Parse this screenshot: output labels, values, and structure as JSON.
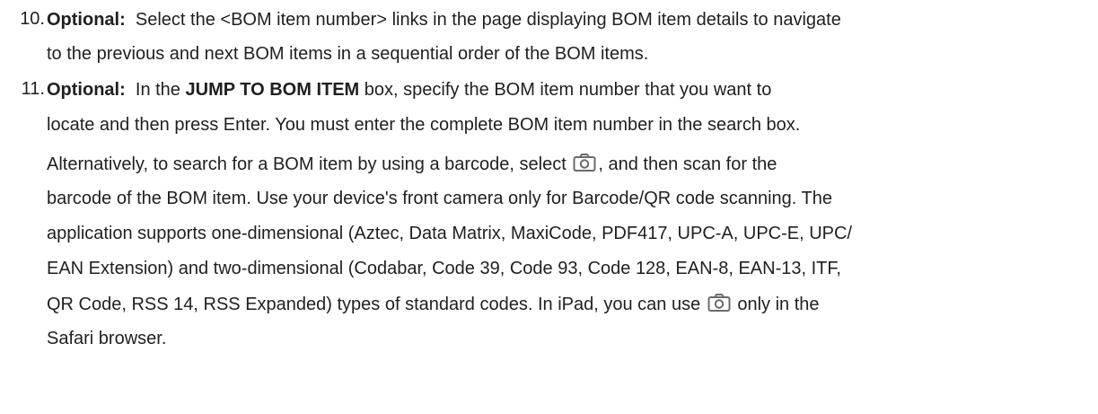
{
  "steps": [
    {
      "number": "10.",
      "optional": "Optional:",
      "lines": [
        "Select the <BOM item number> links in the page displaying BOM item details to navigate",
        "to the previous and next BOM items in a sequential order of the BOM items."
      ]
    },
    {
      "number": "11.",
      "optional": "Optional:",
      "line1_pre": "In the",
      "line1_bold": "JUMP TO BOM ITEM",
      "line1_post": "box, specify the BOM item number that you want to",
      "line2": "locate and then press Enter. You must enter the complete BOM item number in the search box.",
      "p2_line1_pre": "Alternatively, to search for a BOM item by using a barcode, select",
      "p2_line1_post": ", and then scan for the",
      "p2_line2": "barcode of the BOM item. Use your device's front camera only for Barcode/QR code scanning. The",
      "p2_line3": "application supports one-dimensional (Aztec, Data Matrix, MaxiCode, PDF417, UPC-A, UPC-E, UPC/",
      "p2_line4": "EAN Extension) and two-dimensional (Codabar, Code 39, Code 93, Code 128, EAN-8, EAN-13, ITF,",
      "p2_line5_pre": "QR Code, RSS 14, RSS Expanded) types of standard codes. In iPad, you can use",
      "p2_line5_post": "only in the",
      "p2_line6": "Safari browser."
    }
  ],
  "icons": {
    "camera": "camera-icon",
    "color": "#6b6b6b"
  }
}
